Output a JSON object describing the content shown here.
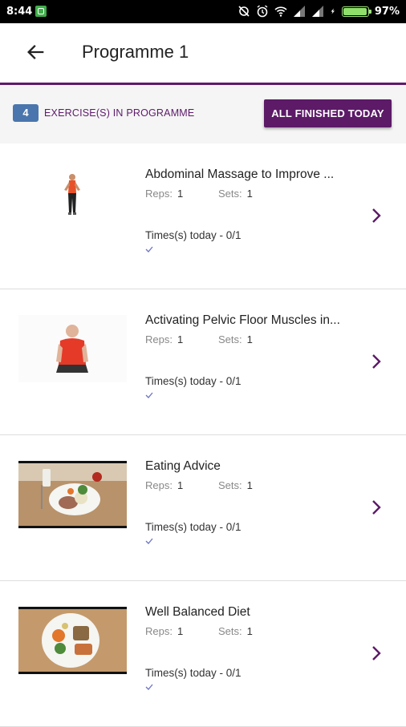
{
  "status_bar": {
    "time": "8:44",
    "battery": "97%",
    "battery_level": 0.97
  },
  "app_bar": {
    "title": "Programme 1",
    "back_icon": "arrow-left-icon"
  },
  "header": {
    "count": "4",
    "label": "EXERCISE(S) IN PROGRAMME",
    "button_label": "ALL FINISHED TODAY"
  },
  "colors": {
    "accent": "#5c1a67",
    "badge": "#4a76ad",
    "check": "#6b73c2"
  },
  "exercises": [
    {
      "name": "Abdominal Massage to Improve ...",
      "reps_label": "Reps:",
      "reps": "1",
      "sets_label": "Sets:",
      "sets": "1",
      "times": "Times(s) today - 0/1",
      "thumb": "woman-standing"
    },
    {
      "name": "Activating Pelvic Floor Muscles in...",
      "reps_label": "Reps:",
      "reps": "1",
      "sets_label": "Sets:",
      "sets": "1",
      "times": "Times(s) today - 0/1",
      "thumb": "man-seated"
    },
    {
      "name": "Eating Advice",
      "reps_label": "Reps:",
      "reps": "1",
      "sets_label": "Sets:",
      "sets": "1",
      "times": "Times(s) today - 0/1",
      "thumb": "dinner-plate"
    },
    {
      "name": "Well Balanced Diet",
      "reps_label": "Reps:",
      "reps": "1",
      "sets_label": "Sets:",
      "sets": "1",
      "times": "Times(s) today - 0/1",
      "thumb": "balanced-plate"
    }
  ]
}
